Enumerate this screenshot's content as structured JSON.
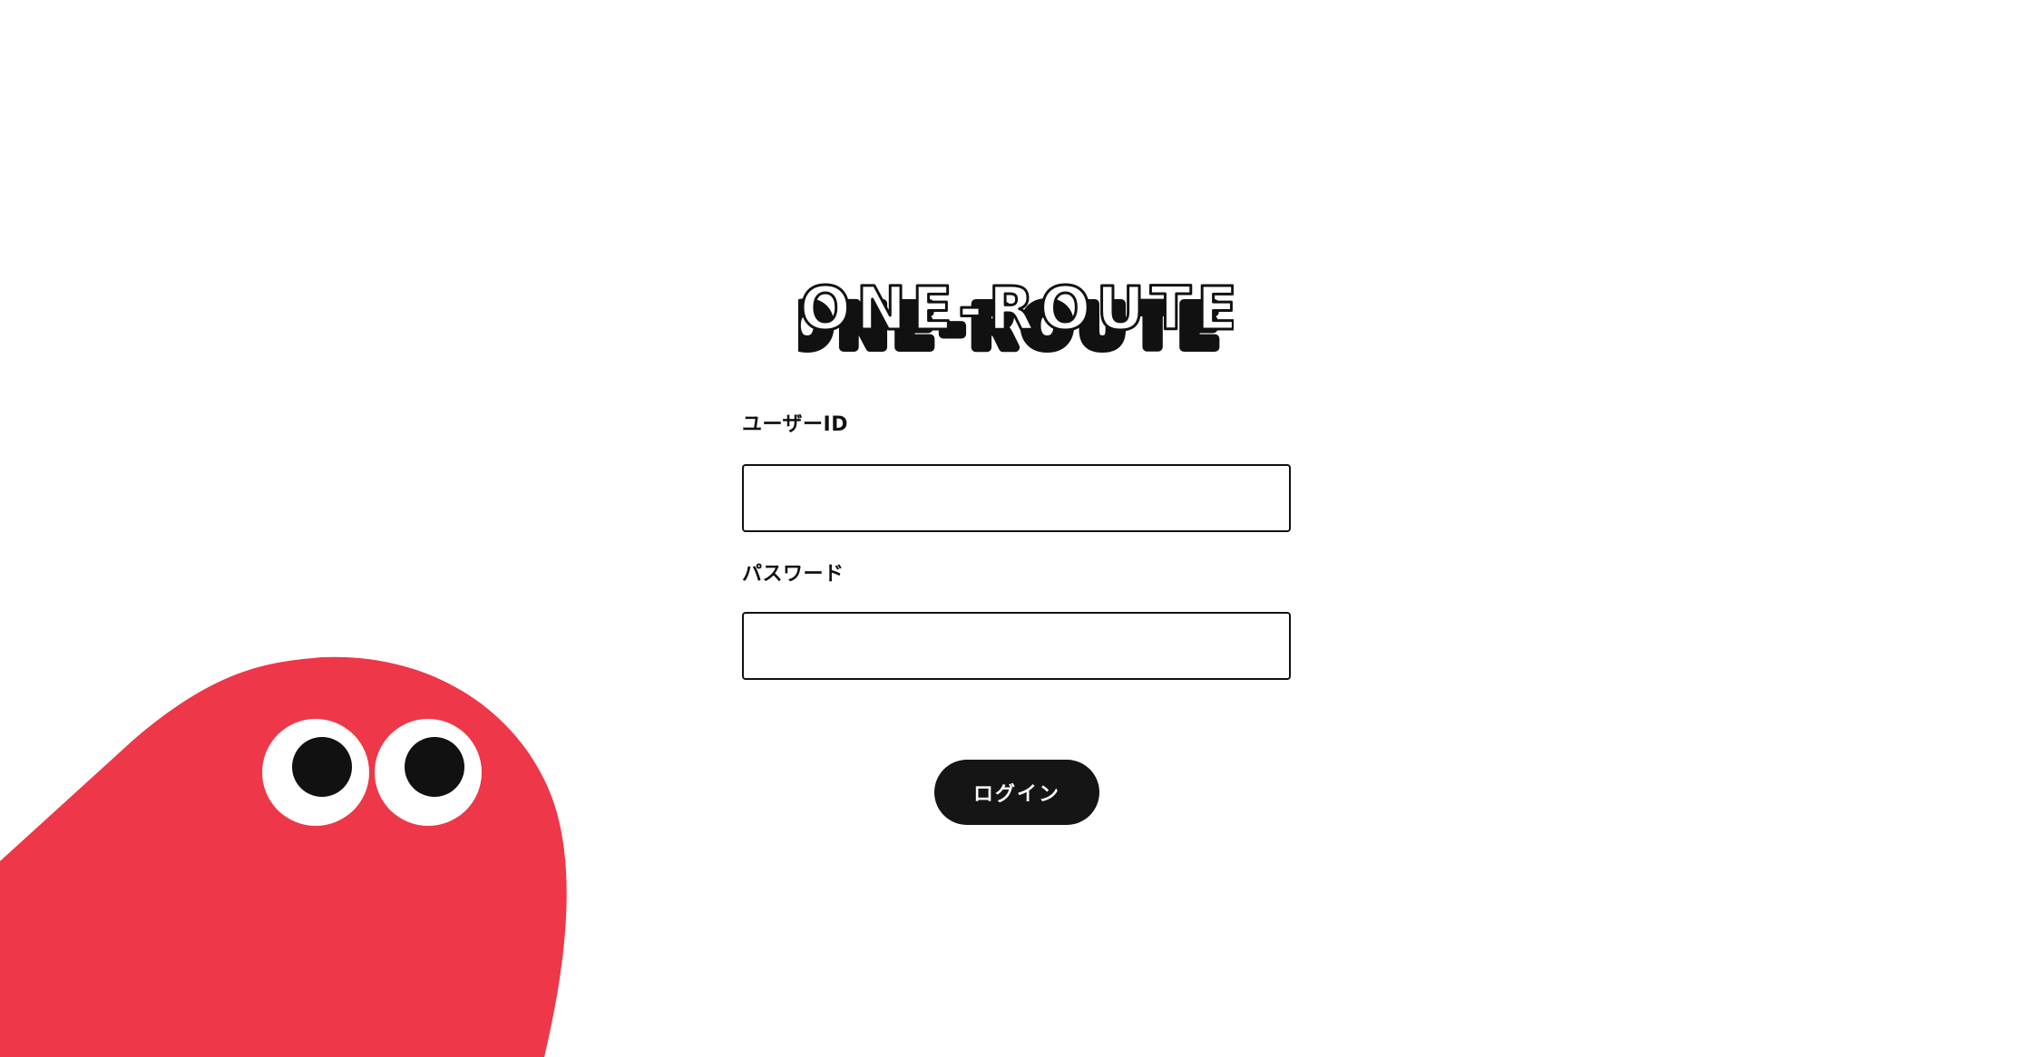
{
  "brand": {
    "name": "ONE-ROUTE",
    "shadow_color": "#111111",
    "letter_fill": "#ffffff"
  },
  "form": {
    "user_id_label": "ユーザーID",
    "user_id_value": "",
    "password_label": "パスワード",
    "password_value": "",
    "login_label": "ログイン"
  },
  "mascot": {
    "icon": "red-blob-mascot-icon",
    "body_color": "#ee3748",
    "eye_white": "#ffffff",
    "pupil_color": "#111111"
  },
  "colors": {
    "background": "#ffffff",
    "text": "#111111",
    "button_bg": "#151515",
    "button_text": "#ffffff"
  }
}
